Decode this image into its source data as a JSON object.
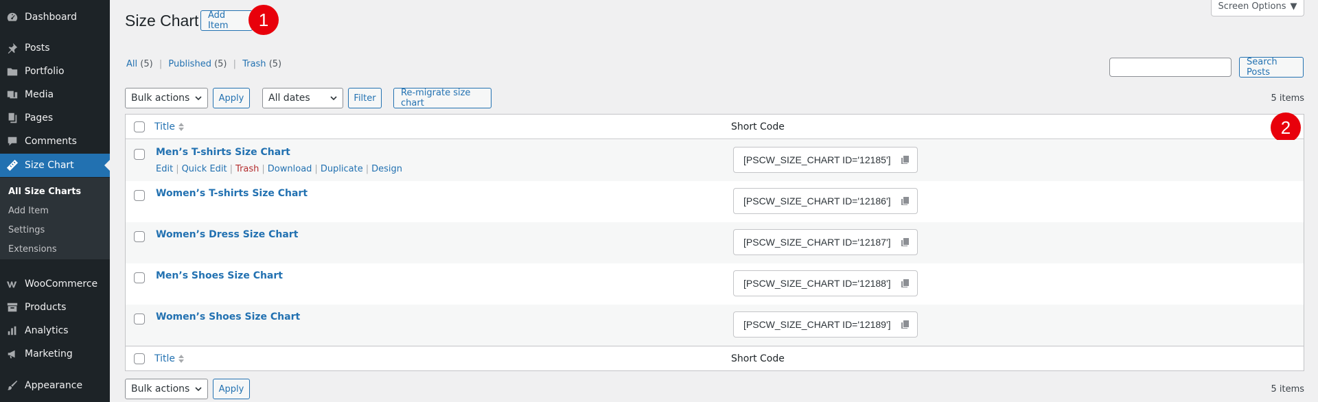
{
  "sidebar": {
    "items": [
      {
        "label": "Dashboard",
        "icon": "dashboard-icon"
      },
      {
        "label": "Posts",
        "icon": "pin-icon"
      },
      {
        "label": "Portfolio",
        "icon": "folder-icon"
      },
      {
        "label": "Media",
        "icon": "media-icon"
      },
      {
        "label": "Pages",
        "icon": "pages-icon"
      },
      {
        "label": "Comments",
        "icon": "comment-icon"
      },
      {
        "label": "Size Chart",
        "icon": "ruler-icon"
      },
      {
        "label": "WooCommerce",
        "icon": "woo-icon"
      },
      {
        "label": "Products",
        "icon": "archive-icon"
      },
      {
        "label": "Analytics",
        "icon": "bar-chart-icon"
      },
      {
        "label": "Marketing",
        "icon": "megaphone-icon"
      },
      {
        "label": "Appearance",
        "icon": "brush-icon"
      }
    ],
    "submenu": [
      "All Size Charts",
      "Add Item",
      "Settings",
      "Extensions"
    ]
  },
  "header": {
    "title": "Size Chart",
    "add_item": "Add Item",
    "marker1": "1",
    "marker2": "2",
    "screen_options": "Screen Options"
  },
  "filters": {
    "all": "All",
    "all_count": "(5)",
    "published": "Published",
    "published_count": "(5)",
    "trash": "Trash",
    "trash_count": "(5)",
    "sep": "|"
  },
  "search": {
    "button": "Search Posts",
    "value": ""
  },
  "toolbar": {
    "bulk_actions": "Bulk actions",
    "apply": "Apply",
    "all_dates": "All dates",
    "filter": "Filter",
    "remigrate": "Re-migrate size chart",
    "items_count": "5 items"
  },
  "table": {
    "col_title": "Title",
    "col_shortcode": "Short Code",
    "rows": [
      {
        "title": "Men’s T-shirts Size Chart",
        "shortcode": "[PSCW_SIZE_CHART ID='12185']"
      },
      {
        "title": "Women’s T-shirts Size Chart",
        "shortcode": "[PSCW_SIZE_CHART ID='12186']"
      },
      {
        "title": "Women’s Dress Size Chart",
        "shortcode": "[PSCW_SIZE_CHART ID='12187']"
      },
      {
        "title": "Men’s Shoes Size Chart",
        "shortcode": "[PSCW_SIZE_CHART ID='12188']"
      },
      {
        "title": "Women’s Shoes Size Chart",
        "shortcode": "[PSCW_SIZE_CHART ID='12189']"
      }
    ],
    "row_actions": {
      "edit": "Edit",
      "quick_edit": "Quick Edit",
      "trash": "Trash",
      "download": "Download",
      "duplicate": "Duplicate",
      "design": "Design"
    }
  }
}
